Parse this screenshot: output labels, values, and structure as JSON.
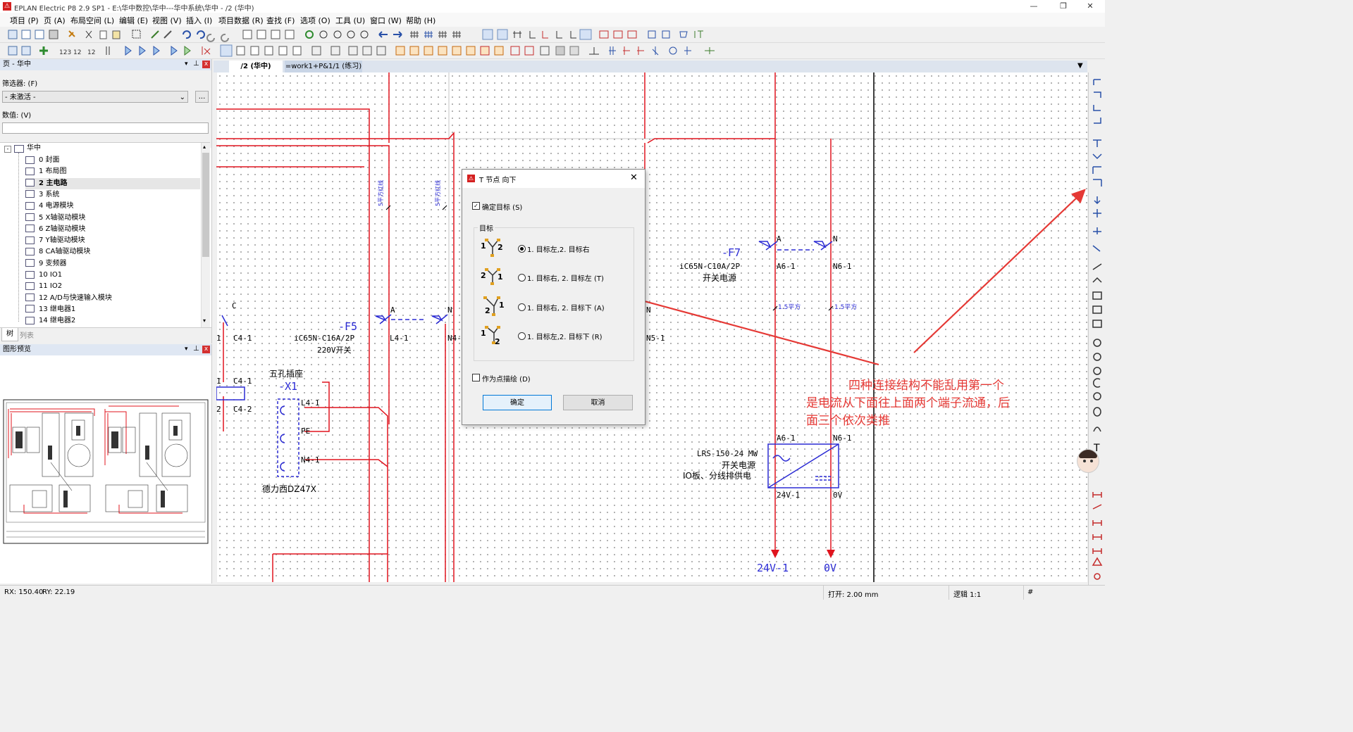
{
  "app": {
    "title": "EPLAN Electric P8 2.9 SP1 - E:\\华中数控\\华中---华中系统\\华中 - /2 (华中)"
  },
  "window_buttons": {
    "minimize": "—",
    "restore": "❐",
    "close": "✕"
  },
  "menu": [
    "项目 (P)",
    "页 (A)",
    "布局空间 (L)",
    "编辑 (E)",
    "视图 (V)",
    "插入 (I)",
    "项目数据 (R)",
    "查找 (F)",
    "选项 (O)",
    "工具 (U)",
    "窗口 (W)",
    "帮助 (H)"
  ],
  "page_panel": {
    "title": "页 - 华中",
    "filter_label": "筛选器: (F)",
    "filter_value": "- 未激活 -",
    "filter_more": "...",
    "value_label": "数值: (V)",
    "value_input": "",
    "tree_root": "华中",
    "items": [
      "0 封面",
      "1 布局图",
      "2 主电路",
      "3 系统",
      "4 电源模块",
      "5 X轴驱动模块",
      "6 Z轴驱动模块",
      "7 Y轴驱动模块",
      "8 CA轴驱动模块",
      "9 变频器",
      "10 IO1",
      "11 IO2",
      "12 A/D与快速输入模块",
      "13 继电器1",
      "14 继电器2"
    ],
    "selected_index": 2,
    "tabs": [
      "树",
      "列表"
    ]
  },
  "preview_panel": {
    "title": "图形预览"
  },
  "doc_tabs": [
    "/2 (华中)",
    "=work1+P&1/1 (练习)"
  ],
  "schematic": {
    "labels": {
      "c_top": "C",
      "c41_left": "1",
      "c41": "C4-1",
      "c41_b": "C4-1",
      "c42_left": "2",
      "c42": "C4-2",
      "c41_b_left": "1",
      "f5": "-F5",
      "f5_desc1": "iC65N-C16A/2P",
      "f5_desc2": "220V开关",
      "a1": "A",
      "n1": "N",
      "l41": "L4-1",
      "n41": "N4-1",
      "n51_tag": "N",
      "n51": "N5-1",
      "wire1": "5平方红线",
      "wire2": "5平方红线",
      "x1_title": "五孔插座",
      "x1": "-X1",
      "x1_l": "L4-1",
      "x1_pe": "PE",
      "x1_n": "N4-1",
      "x1_brand": "德力西DZ47X",
      "f7": "-F7",
      "f7_desc1": "iC65N-C10A/2P",
      "f7_desc2": "开关电源",
      "a2": "A",
      "n2": "N",
      "a61": "A6-1",
      "n61": "N6-1",
      "w15a": "1.5平方",
      "w15b": "1.5平方",
      "a61b": "A6-1",
      "n61b": "N6-1",
      "psu_model": "LRS-150-24 MW",
      "psu_desc1": "开关电源",
      "psu_desc2": "IO板、分线排供电",
      "v24_pin": "24V-1",
      "v0_pin": "0V",
      "out24": "24V-1",
      "out0": "0V"
    },
    "annotation": "四种连接结构不能乱用第一个是电流从下面往上面两个端子流通，后面三个依次类推"
  },
  "dialog": {
    "title": "T 节点 向下",
    "confirm_target": "确定目标 (S)",
    "group_title": "目标",
    "options": [
      "1. 目标左,2. 目标右",
      "1. 目标右, 2. 目标左 (T)",
      "1. 目标右, 2. 目标下 (A)",
      "1. 目标左,2. 目标下 (R)"
    ],
    "selected_option": 0,
    "as_point": "作为点描绘 (D)",
    "ok": "确定",
    "cancel": "取消"
  },
  "status": {
    "rx": "RX: 150.40",
    "ry": "RY: 22.19",
    "grid": "打开: 2.00 mm",
    "logic": "逻辑 1:1",
    "hash": "#"
  },
  "colors": {
    "wire": "#e0141e",
    "blue": "#2b2bd4",
    "annotation": "#e53935",
    "panel_head": "#dfe7f3"
  }
}
